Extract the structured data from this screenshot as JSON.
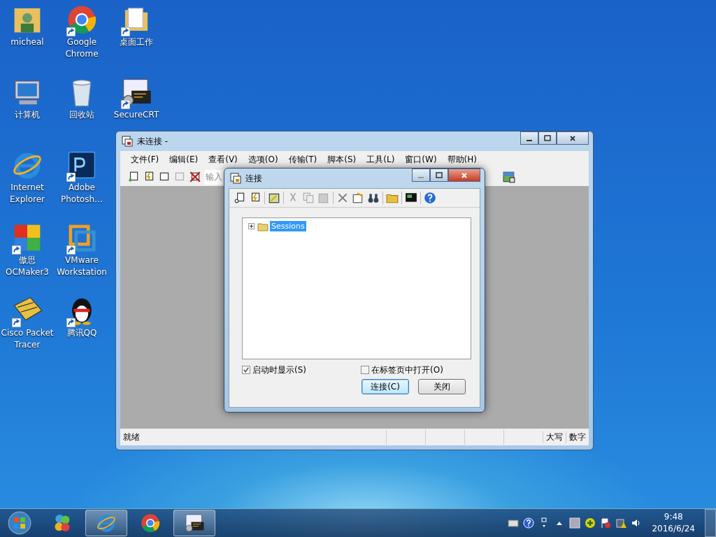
{
  "desktop_icons": [
    {
      "label": "micheal",
      "kind": "user-folder",
      "shortcut": false
    },
    {
      "label": "计算机",
      "kind": "computer",
      "shortcut": false
    },
    {
      "label": "Internet Explorer",
      "kind": "ie",
      "shortcut": false
    },
    {
      "label": "傲思 OCMaker3",
      "kind": "puzzle",
      "shortcut": true
    },
    {
      "label": "Cisco Packet Tracer",
      "kind": "envelope",
      "shortcut": true
    },
    {
      "label": "Google Chrome",
      "kind": "chrome",
      "shortcut": true
    },
    {
      "label": "回收站",
      "kind": "trash",
      "shortcut": false
    },
    {
      "label": "Adobe Photosh…",
      "kind": "ps",
      "shortcut": true
    },
    {
      "label": "VMware Workstation",
      "kind": "vmware",
      "shortcut": true
    },
    {
      "label": "腾讯QQ",
      "kind": "penguin",
      "shortcut": true
    },
    {
      "label": "桌面工作",
      "kind": "folder",
      "shortcut": true
    },
    {
      "label": "SecureCRT",
      "kind": "terminal",
      "shortcut": true
    }
  ],
  "main_window": {
    "title": "未连接 -",
    "menu": [
      "文件(F)",
      "编辑(E)",
      "查看(V)",
      "选项(O)",
      "传输(T)",
      "脚本(S)",
      "工具(L)",
      "窗口(W)",
      "帮助(H)"
    ],
    "quick_connect": {
      "placeholder": "输入"
    },
    "status_bar": {
      "text": "就绪",
      "indicators": [
        "大写",
        "数字"
      ]
    }
  },
  "dialog": {
    "title": "连接",
    "tree": [
      {
        "label": "Sessions",
        "selected": true,
        "expanded": false
      }
    ],
    "checkboxes": [
      {
        "label": "启动时显示(S)",
        "checked": true
      },
      {
        "label": "在标签页中打开(O)",
        "checked": false
      }
    ],
    "buttons": [
      {
        "label": "连接(C)",
        "default": true
      },
      {
        "label": "关闭",
        "default": false
      }
    ]
  },
  "taskbar": {
    "apps": [
      {
        "kind": "pinwheel",
        "active": false
      },
      {
        "kind": "ie",
        "active": true
      },
      {
        "kind": "chrome",
        "active": false
      },
      {
        "kind": "terminal",
        "active": true
      }
    ],
    "time": "9:48",
    "date": "2016/6/24"
  }
}
